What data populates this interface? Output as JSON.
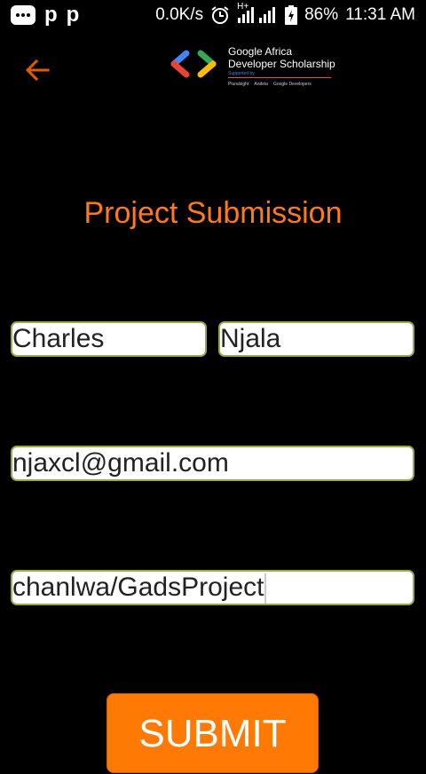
{
  "status_bar": {
    "net_speed": "0.0K/s",
    "network_type": "H+",
    "battery": "86%",
    "time": "11:31 AM"
  },
  "header": {
    "logo_line1": "Google Africa",
    "logo_line2": "Developer Scholarship",
    "logo_supported": "Supported by",
    "logo_partners": [
      "Pluralsight",
      "Andela",
      "Google Developers"
    ]
  },
  "page_title": "Project Submission",
  "form": {
    "first_name": "Charles",
    "last_name": "Njala",
    "email": "njaxcl@gmail.com",
    "github_link": "chanlwa/GadsProject"
  },
  "submit_label": "SUBMIT",
  "colors": {
    "accent": "#ff7a1a",
    "field_border": "#9aa84a",
    "button": "#ff7a05"
  }
}
